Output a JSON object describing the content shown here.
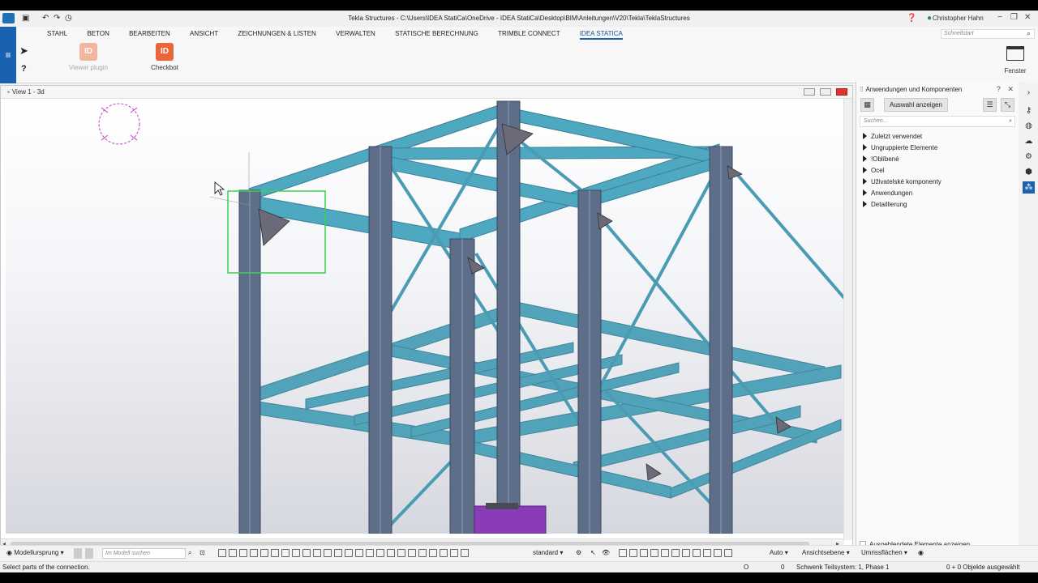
{
  "window": {
    "title": "Tekla Structures - C:\\Users\\IDEA StatiCa\\OneDrive - IDEA StatiCa\\Desktop\\BIM\\Anleitungen\\V20\\Tekla\\TeklaStructures",
    "user": "Christopher Hahn"
  },
  "ribbon": {
    "tabs": [
      "STAHL",
      "BETON",
      "BEARBEITEN",
      "ANSICHT",
      "ZEICHNUNGEN & LISTEN",
      "VERWALTEN",
      "STATISCHE BERECHNUNG",
      "TRIMBLE CONNECT",
      "IDEA STATICA"
    ],
    "active_tab": "IDEA STATICA",
    "quick_search_placeholder": "Schnellstart",
    "tools": {
      "viewer_plugin": "Viewer plugin",
      "checkbot": "Checkbot",
      "fenster": "Fenster"
    }
  },
  "view": {
    "title": "View 1 - 3d"
  },
  "panel": {
    "title": "Anwendungen und Komponenten",
    "selection_button": "Auswahl anzeigen",
    "search_placeholder": "Suchen...",
    "items": [
      "Zuletzt verwendet",
      "Ungruppierte Elemente",
      "!Oblíbené",
      "Ocel",
      "Uživatelské komponenty",
      "Anwendungen",
      "Detaillierung"
    ],
    "footer_checkbox": "Ausgeblendete Elemente anzeigen"
  },
  "bottombar": {
    "origin": "Modellursprung",
    "model_search_placeholder": "Im Modell suchen",
    "filter": "standard",
    "auto": "Auto",
    "view_plane": "Ansichtsebene",
    "outline": "Umrissflächen"
  },
  "status": {
    "prompt": "Select parts of the connection.",
    "o_label": "O",
    "zero": "0",
    "subsystem": "Schwenk Teilsystem: 1, Phase 1",
    "selected": "0 + 0 Objekte ausgewählt"
  },
  "colors": {
    "accent": "#1a62b0",
    "steel": "#4a90a8",
    "column": "#5e6e88",
    "selection": "#39d24a",
    "idea_orange": "#e8663a"
  }
}
